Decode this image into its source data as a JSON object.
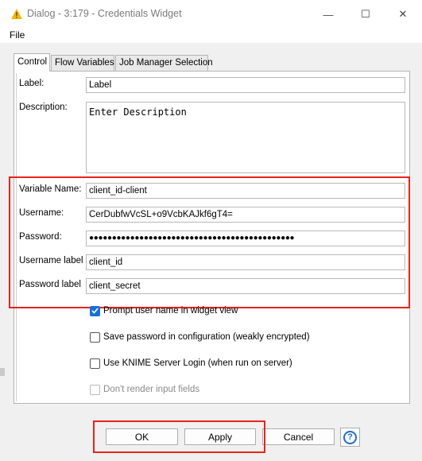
{
  "window": {
    "title": "Dialog - 3:179 - Credentials Widget",
    "minimize_glyph": "—",
    "maximize_glyph": "☐",
    "close_glyph": "✕"
  },
  "menu": {
    "file": "File"
  },
  "tabs": [
    {
      "label": "Control",
      "active": true
    },
    {
      "label": "Flow Variables",
      "active": false
    },
    {
      "label": "Job Manager Selection",
      "active": false
    }
  ],
  "form": {
    "label": {
      "label": "Label:",
      "value": "Label"
    },
    "description": {
      "label": "Description:",
      "value": "Enter Description"
    },
    "variable_name": {
      "label": "Variable Name:",
      "value": "client_id-client"
    },
    "username": {
      "label": "Username:",
      "value": "CerDubfwVcSL+o9VcbKAJkf6gT4="
    },
    "password": {
      "label": "Password:",
      "value": "●●●●●●●●●●●●●●●●●●●●●●●●●●●●●●●●●●●●●●●●●●●●●"
    },
    "username_label": {
      "label": "Username label",
      "value": "client_id"
    },
    "password_label": {
      "label": "Password label",
      "value": "client_secret"
    }
  },
  "options": [
    {
      "label": "Prompt user name in widget view",
      "checked": true,
      "disabled": false
    },
    {
      "label": "Save password in configuration (weakly encrypted)",
      "checked": false,
      "disabled": false
    },
    {
      "label": "Use KNIME Server Login (when run on server)",
      "checked": false,
      "disabled": false
    },
    {
      "label": "Don't render input fields",
      "checked": false,
      "disabled": true
    }
  ],
  "buttons": {
    "ok": "OK",
    "apply": "Apply",
    "cancel": "Cancel",
    "help": "?"
  },
  "colors": {
    "highlight": "#e8231b",
    "accent": "#1a6fd6",
    "warning_icon": "#f2b705"
  },
  "icons": {
    "app": "warning-triangle-icon",
    "help": "help-icon"
  }
}
